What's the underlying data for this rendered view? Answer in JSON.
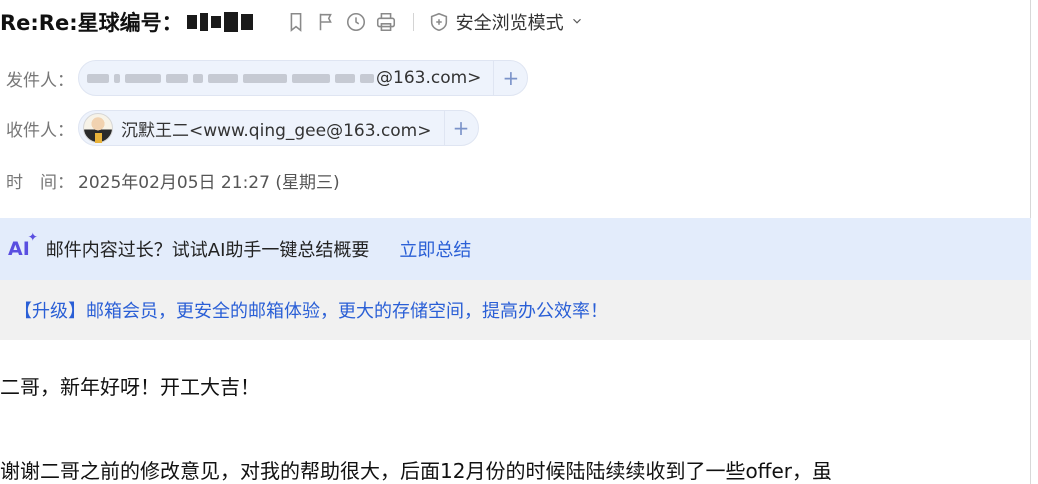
{
  "subject": {
    "text": "Re:Re:星球编号："
  },
  "toolbar": {
    "bookmark_icon": "bookmark-icon",
    "flag_icon": "flag-icon",
    "clock_icon": "clock-icon",
    "print_icon": "print-icon",
    "safe_mode_label": "安全浏览模式"
  },
  "sender": {
    "label": "发件人：",
    "email_suffix": "@163.com>"
  },
  "recipient": {
    "label": "收件人：",
    "name_email": "沉默王二<www.qing_gee@163.com>"
  },
  "date": {
    "label": "时　间：",
    "value": "2025年02月05日 21:27 (星期三)"
  },
  "ai_banner": {
    "badge": "AI",
    "text": "邮件内容过长？试试AI助手一键总结概要",
    "link": "立即总结"
  },
  "upgrade_banner": {
    "text": "【升级】邮箱会员，更安全的邮箱体验，更大的存储空间，提高办公效率！"
  },
  "body": {
    "line1": "二哥，新年好呀！开工大吉！",
    "line2": "谢谢二哥之前的修改意见，对我的帮助很大，后面12月份的时候陆陆续续收到了一些offer，虽"
  },
  "colors": {
    "accent": "#2a5fd6",
    "ai_bg": "#e3ecfb",
    "upgrade_bg": "#f1f1f1",
    "ai_purple": "#5a4fe0"
  }
}
